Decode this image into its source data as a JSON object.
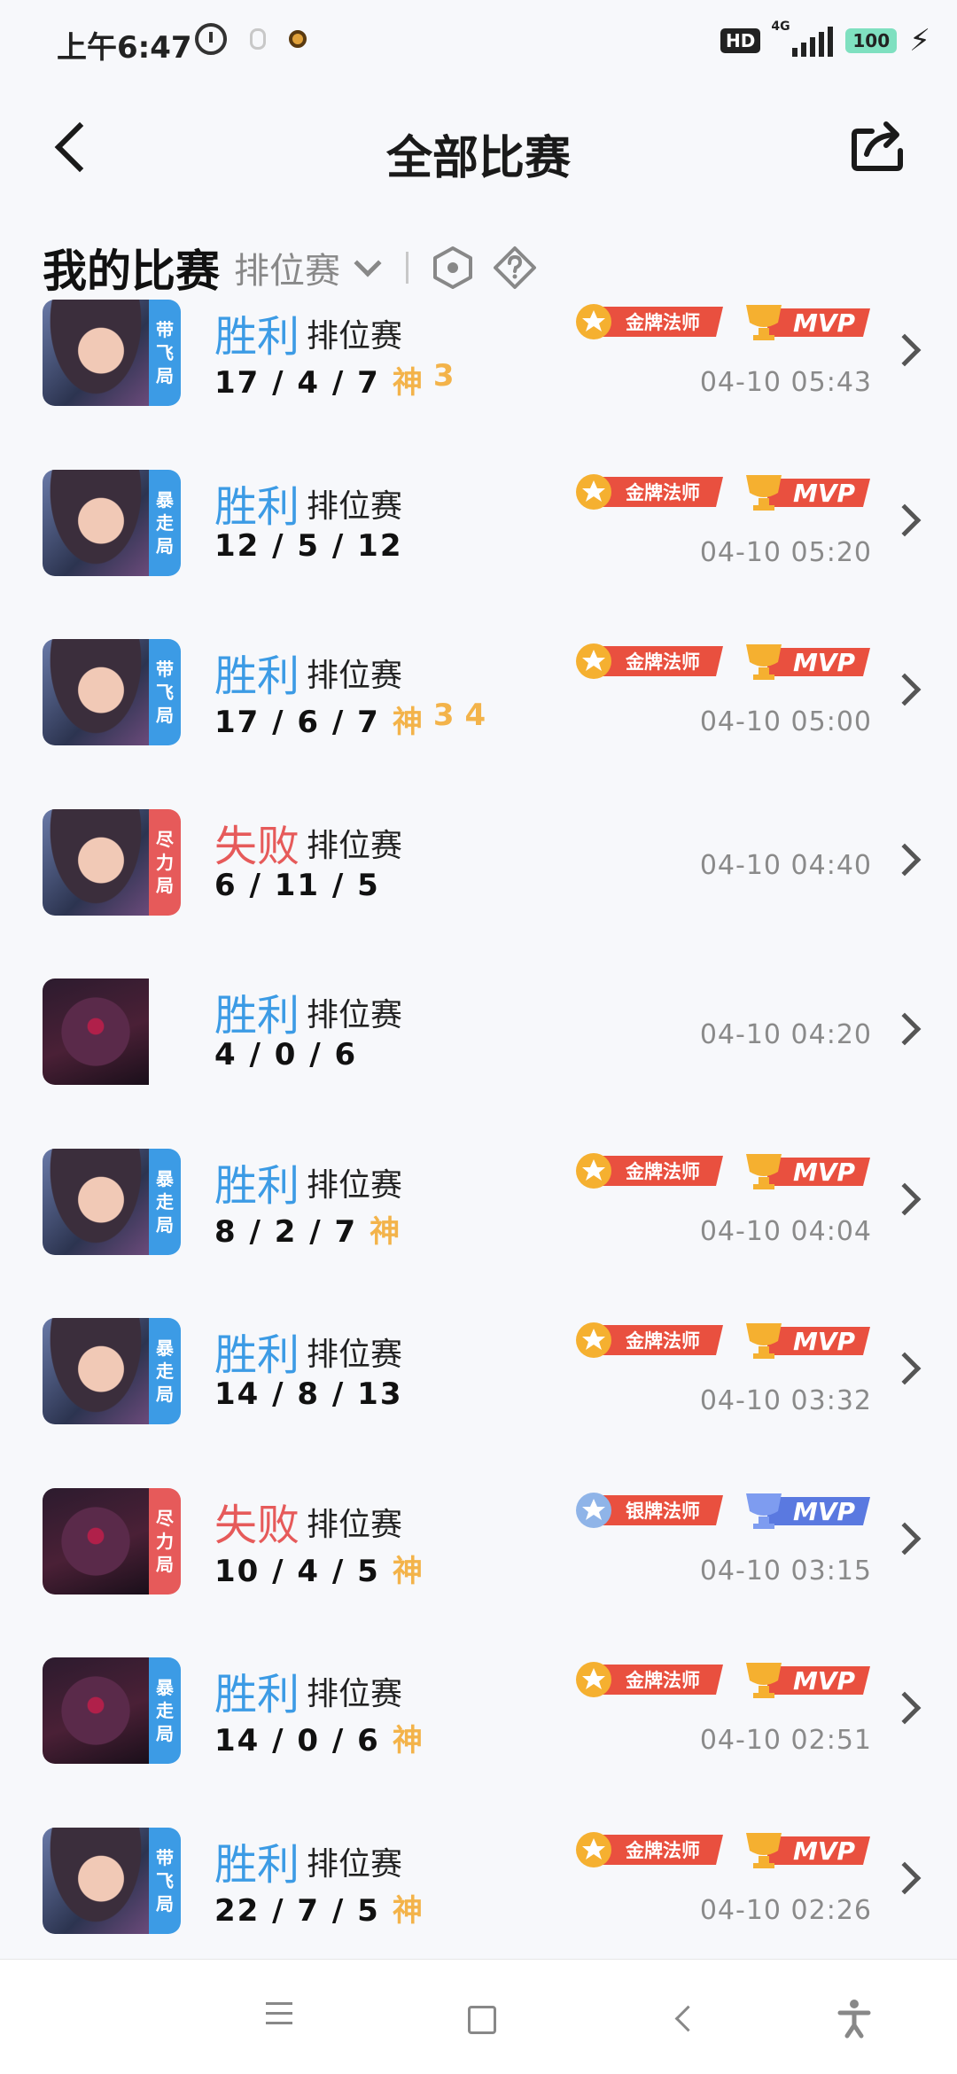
{
  "status_bar": {
    "time": "上午6:47",
    "network_label": "4G",
    "hd_label": "HD",
    "battery": "100"
  },
  "header": {
    "title": "全部比赛"
  },
  "filter": {
    "title": "我的比赛",
    "type": "排位赛"
  },
  "matches": [
    {
      "result": "胜利",
      "outcome": "win",
      "mode": "排位赛",
      "kda": "17 / 4 / 7",
      "badges": [
        "神",
        "3"
      ],
      "time": "04-10 05:43",
      "tag": [
        "带",
        "飞",
        "局"
      ],
      "tag_color": "blue",
      "hero": "a",
      "medal": "金牌法师",
      "medal_type": "gold",
      "mvp": "MVP",
      "mvp_type": "gold"
    },
    {
      "result": "胜利",
      "outcome": "win",
      "mode": "排位赛",
      "kda": "12 / 5 / 12",
      "badges": [],
      "time": "04-10 05:20",
      "tag": [
        "暴",
        "走",
        "局"
      ],
      "tag_color": "blue",
      "hero": "a",
      "medal": "金牌法师",
      "medal_type": "gold",
      "mvp": "MVP",
      "mvp_type": "gold"
    },
    {
      "result": "胜利",
      "outcome": "win",
      "mode": "排位赛",
      "kda": "17 / 6 / 7",
      "badges": [
        "神",
        "3",
        "4"
      ],
      "time": "04-10 05:00",
      "tag": [
        "带",
        "飞",
        "局"
      ],
      "tag_color": "blue",
      "hero": "a",
      "medal": "金牌法师",
      "medal_type": "gold",
      "mvp": "MVP",
      "mvp_type": "gold"
    },
    {
      "result": "失败",
      "outcome": "loss",
      "mode": "排位赛",
      "kda": "6 / 11 / 5",
      "badges": [],
      "time": "04-10 04:40",
      "tag": [
        "尽",
        "力",
        "局"
      ],
      "tag_color": "red",
      "hero": "a",
      "medal": "",
      "medal_type": "",
      "mvp": "",
      "mvp_type": ""
    },
    {
      "result": "胜利",
      "outcome": "win",
      "mode": "排位赛",
      "kda": "4 / 0 / 6",
      "badges": [],
      "time": "04-10 04:20",
      "tag": [],
      "tag_color": "",
      "hero": "b",
      "medal": "",
      "medal_type": "",
      "mvp": "",
      "mvp_type": ""
    },
    {
      "result": "胜利",
      "outcome": "win",
      "mode": "排位赛",
      "kda": "8 / 2 / 7",
      "badges": [
        "神"
      ],
      "time": "04-10 04:04",
      "tag": [
        "暴",
        "走",
        "局"
      ],
      "tag_color": "blue",
      "hero": "a",
      "medal": "金牌法师",
      "medal_type": "gold",
      "mvp": "MVP",
      "mvp_type": "gold"
    },
    {
      "result": "胜利",
      "outcome": "win",
      "mode": "排位赛",
      "kda": "14 / 8 / 13",
      "badges": [],
      "time": "04-10 03:32",
      "tag": [
        "暴",
        "走",
        "局"
      ],
      "tag_color": "blue",
      "hero": "a",
      "medal": "金牌法师",
      "medal_type": "gold",
      "mvp": "MVP",
      "mvp_type": "gold"
    },
    {
      "result": "失败",
      "outcome": "loss",
      "mode": "排位赛",
      "kda": "10 / 4 / 5",
      "badges": [
        "神"
      ],
      "time": "04-10 03:15",
      "tag": [
        "尽",
        "力",
        "局"
      ],
      "tag_color": "red",
      "hero": "b",
      "medal": "银牌法师",
      "medal_type": "silver",
      "mvp": "MVP",
      "mvp_type": "silver"
    },
    {
      "result": "胜利",
      "outcome": "win",
      "mode": "排位赛",
      "kda": "14 / 0 / 6",
      "badges": [
        "神"
      ],
      "time": "04-10 02:51",
      "tag": [
        "暴",
        "走",
        "局"
      ],
      "tag_color": "blue",
      "hero": "b",
      "medal": "金牌法师",
      "medal_type": "gold",
      "mvp": "MVP",
      "mvp_type": "gold"
    },
    {
      "result": "胜利",
      "outcome": "win",
      "mode": "排位赛",
      "kda": "22 / 7 / 5",
      "badges": [
        "神"
      ],
      "time": "04-10 02:26",
      "tag": [
        "带",
        "飞",
        "局"
      ],
      "tag_color": "blue",
      "hero": "a",
      "medal": "金牌法师",
      "medal_type": "gold",
      "mvp": "MVP",
      "mvp_type": "gold"
    }
  ],
  "colors": {
    "win": "#3c9be5",
    "loss": "#e65a5a",
    "badge": "#f3b34a",
    "gold_medal": "#e9503f",
    "silver_medal": "#e9503f",
    "silver_mvp": "#5a79e0"
  },
  "nav": {
    "icons": [
      "menu-icon",
      "home-icon",
      "back-icon",
      "accessibility-icon"
    ]
  }
}
